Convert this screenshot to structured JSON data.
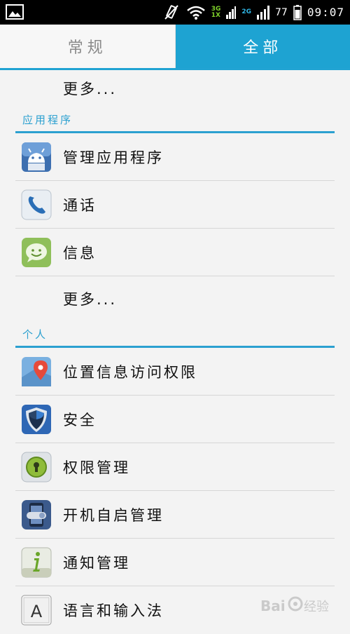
{
  "status_bar": {
    "net_top": "3G",
    "net_bottom": "1X",
    "net2": "2G",
    "battery": "77",
    "time": "09:07"
  },
  "tabs": [
    {
      "label": "常规",
      "selected": false
    },
    {
      "label": "全部",
      "selected": true
    }
  ],
  "list": {
    "more_top": "更多...",
    "apps_section": "应用程序",
    "apps": [
      {
        "label": "管理应用程序",
        "icon": "android-icon"
      },
      {
        "label": "通话",
        "icon": "phone-icon"
      },
      {
        "label": "信息",
        "icon": "message-icon"
      }
    ],
    "more_apps": "更多...",
    "personal_section": "个人",
    "personal": [
      {
        "label": "位置信息访问权限",
        "icon": "location-icon"
      },
      {
        "label": "安全",
        "icon": "shield-icon"
      },
      {
        "label": "权限管理",
        "icon": "lock-icon"
      },
      {
        "label": "开机自启管理",
        "icon": "toggle-icon"
      },
      {
        "label": "通知管理",
        "icon": "info-icon"
      },
      {
        "label": "语言和输入法",
        "icon": "keyboard-icon"
      }
    ]
  },
  "colors": {
    "accent": "#1ea3d2",
    "status_bar": "#000000",
    "background": "#f3f3f3"
  }
}
